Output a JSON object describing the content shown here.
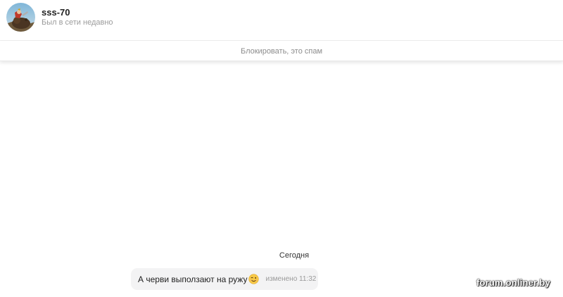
{
  "header": {
    "username": "sss-70",
    "status": "Был в сети недавно",
    "avatar_icon": "user-avatar"
  },
  "block_bar": {
    "label": "Блокировать, это спам"
  },
  "conversation": {
    "date_separator": "Сегодня",
    "messages": [
      {
        "text": "А черви выползают на ружу",
        "emoji": "wink-emoji",
        "edited_label": "изменено 11:32"
      }
    ]
  },
  "watermark": "forum.onliner.by",
  "colors": {
    "bubble_bg": "#f3f3f4",
    "muted_text": "#9b9b9b",
    "emoji_yellow": "#f7c948"
  }
}
